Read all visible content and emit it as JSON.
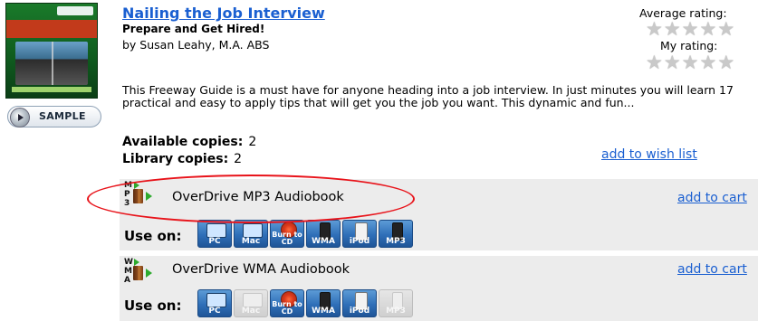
{
  "book": {
    "title": "Nailing the Job Interview",
    "subtitle": "Prepare and Get Hired!",
    "author": "by Susan Leahy, M.A. ABS",
    "description": "This Freeway Guide is a must have for anyone heading into a job interview. In just minutes you will learn 17 practical and easy to apply tips that will get you the job you want. This dynamic and fun...",
    "sample_label": "SAMPLE"
  },
  "ratings": {
    "average_label": "Average rating:",
    "my_label": "My rating:",
    "average_stars": 0,
    "my_stars": 0,
    "max_stars": 5
  },
  "availability": {
    "available_label": "Available copies:",
    "available_value": "2",
    "library_label": "Library copies:",
    "library_value": "2",
    "wish_list_label": "add to wish list"
  },
  "formats": [
    {
      "name": "OverDrive MP3 Audiobook",
      "letters": [
        "M",
        "P",
        "3"
      ],
      "add_to_cart_label": "add to cart",
      "use_on_label": "Use on:",
      "devices": [
        {
          "label": "PC",
          "icon": "pc-icon",
          "enabled": true
        },
        {
          "label": "Mac",
          "icon": "mac-icon",
          "enabled": true
        },
        {
          "label": "Burn to CD",
          "icon": "burn-cd-icon",
          "enabled": true
        },
        {
          "label": "WMA",
          "icon": "wma-player-icon",
          "enabled": true
        },
        {
          "label": "iPod",
          "icon": "ipod-icon",
          "enabled": true
        },
        {
          "label": "MP3",
          "icon": "mp3-player-icon",
          "enabled": true
        }
      ],
      "highlighted": true
    },
    {
      "name": "OverDrive WMA Audiobook",
      "letters": [
        "W",
        "M",
        "A"
      ],
      "add_to_cart_label": "add to cart",
      "use_on_label": "Use on:",
      "devices": [
        {
          "label": "PC",
          "icon": "pc-icon",
          "enabled": true
        },
        {
          "label": "Mac",
          "icon": "mac-icon",
          "enabled": false
        },
        {
          "label": "Burn to CD",
          "icon": "burn-cd-icon",
          "enabled": true
        },
        {
          "label": "WMA",
          "icon": "wma-player-icon",
          "enabled": true
        },
        {
          "label": "iPod",
          "icon": "ipod-icon",
          "enabled": true
        },
        {
          "label": "MP3",
          "icon": "mp3-player-icon",
          "enabled": false
        }
      ],
      "highlighted": false
    }
  ],
  "colors": {
    "link": "#1a5fd1",
    "panel_bg": "#ececec",
    "highlight_ellipse": "#e8131a",
    "device_button": "#2f6fb8"
  }
}
